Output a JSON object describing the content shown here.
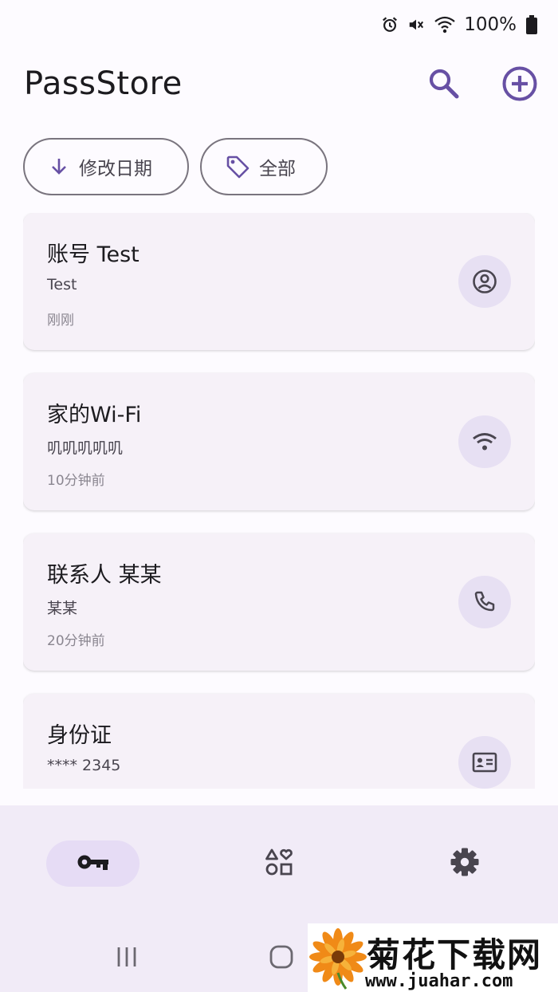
{
  "status_bar": {
    "battery_percent": "100%",
    "icons": [
      "alarm-icon",
      "vibrate-mute-icon",
      "wifi-icon",
      "battery-icon"
    ]
  },
  "header": {
    "title": "PassStore",
    "actions": [
      "search-icon",
      "add-circle-icon"
    ]
  },
  "filters": {
    "sort_label": "修改日期",
    "sort_icon": "arrow-down-icon",
    "tag_label": "全部",
    "tag_icon": "tag-icon"
  },
  "entries": [
    {
      "title": "账号 Test",
      "subtitle": "Test",
      "time": "刚刚",
      "icon": "account-circle-icon"
    },
    {
      "title": "家的Wi-Fi",
      "subtitle": "叽叽叽叽叽",
      "time": "10分钟前",
      "icon": "wifi-icon"
    },
    {
      "title": "联系人 某某",
      "subtitle": "某某",
      "time": "20分钟前",
      "icon": "phone-icon"
    },
    {
      "title": "身份证",
      "subtitle": "**** 2345",
      "time": "",
      "icon": "id-card-icon"
    }
  ],
  "bottom_nav": {
    "items": [
      "key-icon",
      "categories-icon",
      "settings-gear-icon"
    ],
    "selected": "key-icon"
  },
  "watermark": {
    "title": "菊花下载网",
    "url": "www.juahar.com"
  },
  "colors": {
    "accent": "#6750a4",
    "card_bg": "#f6f1f8",
    "icon_circle": "#e7e0f3",
    "nav_bg": "#f1ebf7",
    "nav_selected": "#e6dcf5"
  }
}
